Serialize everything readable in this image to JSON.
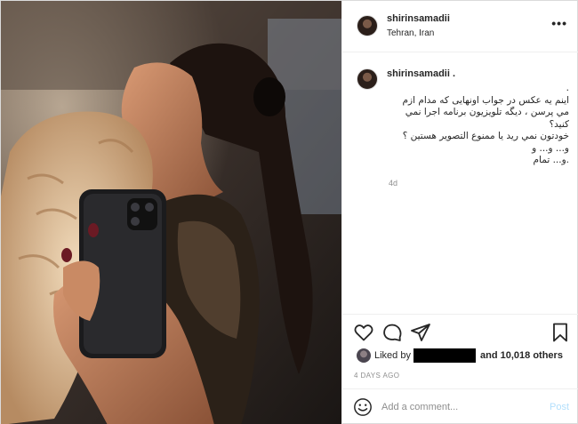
{
  "post": {
    "username": "shirinsamadii",
    "location": "Tehran, Iran",
    "more_icon": "more-horizontal-icon",
    "caption": {
      "username": "shirinsamadii .",
      "text": ".\nاینم یه عکس در جواب اونهایی که مدام ازم مي پرسن ، ديگه تلويزيون برنامه اجرا نمي کنید؟\nخودتون نمي ريد يا ممنوع التصوير هستين ؟ و... و... و\n.و... تمام",
      "time": "4d"
    },
    "actions": {
      "like_icon": "heart-icon",
      "comment_icon": "comment-icon",
      "share_icon": "share-icon",
      "save_icon": "bookmark-icon"
    },
    "likes": {
      "prefix": "Liked by",
      "others": "and 10,018 others"
    },
    "timestamp": "4 DAYS AGO",
    "comment": {
      "placeholder": "Add a comment...",
      "post_label": "Post",
      "emoji_icon": "smile-icon"
    }
  }
}
